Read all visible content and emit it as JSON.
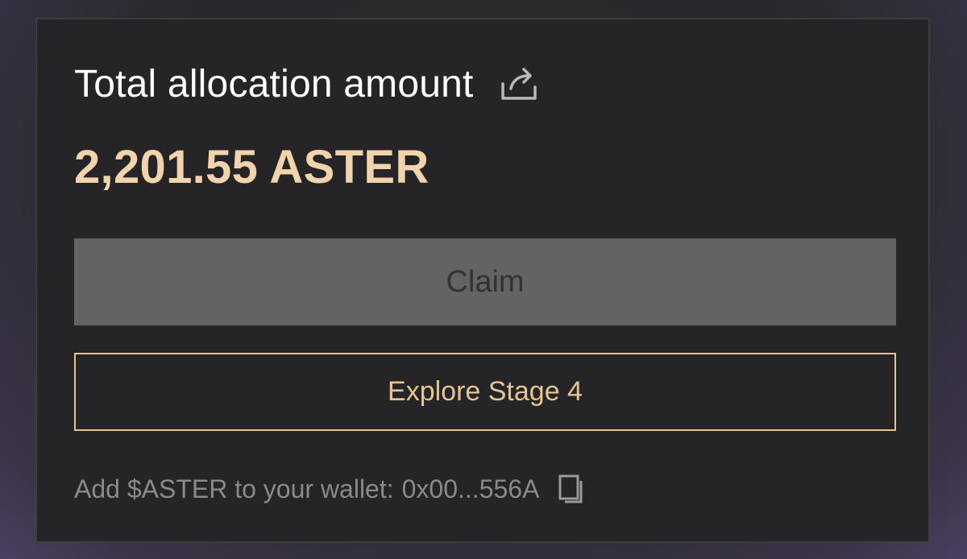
{
  "card": {
    "title": "Total allocation amount",
    "share_icon": "share-icon",
    "amount": "2,201.55 ASTER",
    "claim_label": "Claim",
    "explore_label": "Explore Stage 4",
    "wallet_prefix": "Add $ASTER to your wallet:",
    "wallet_address": "0x00...556A",
    "copy_icon": "copy-icon"
  },
  "colors": {
    "accent": "#e7c391",
    "amount": "#f1d3ac",
    "card_bg": "#252427",
    "claim_disabled_bg": "#636363"
  }
}
